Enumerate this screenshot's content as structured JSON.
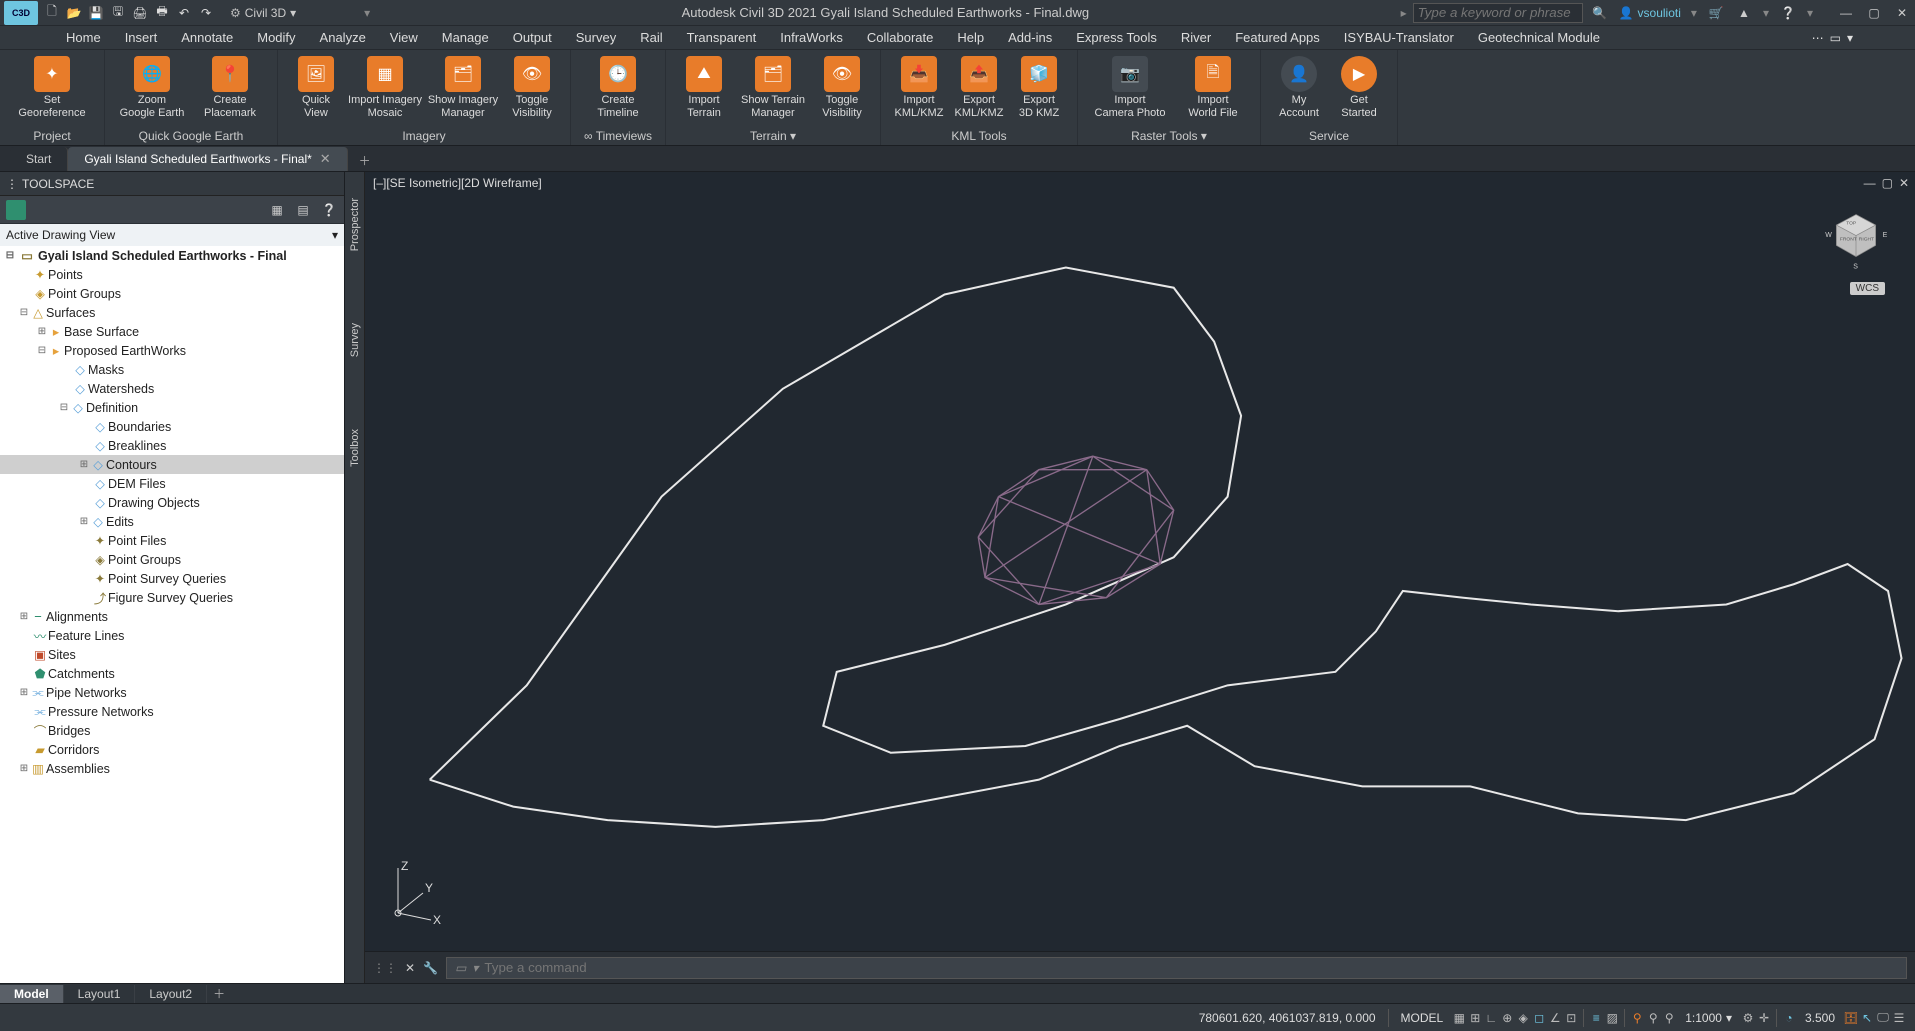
{
  "titlebar": {
    "logo": "C3D",
    "workspace": "Civil 3D",
    "app_title": "Autodesk Civil 3D 2021   Gyali Island Scheduled Earthworks - Final.dwg",
    "search_placeholder": "Type a keyword or phrase",
    "username": "vsoulioti"
  },
  "menu": [
    "Home",
    "Insert",
    "Annotate",
    "Modify",
    "Analyze",
    "View",
    "Manage",
    "Output",
    "Survey",
    "Rail",
    "Transparent",
    "InfraWorks",
    "Collaborate",
    "Help",
    "Add-ins",
    "Express Tools",
    "River",
    "Featured Apps",
    "ISYBAU-Translator",
    "Geotechnical Module"
  ],
  "ribbon": {
    "panels": [
      {
        "title": "Project",
        "buttons": [
          {
            "l1": "Set",
            "l2": "Georeference"
          }
        ]
      },
      {
        "title": "Quick Google Earth",
        "buttons": [
          {
            "l1": "Zoom",
            "l2": "Google Earth"
          },
          {
            "l1": "Create",
            "l2": "Placemark"
          }
        ]
      },
      {
        "title": "Imagery",
        "buttons": [
          {
            "l1": "Quick",
            "l2": "View"
          },
          {
            "l1": "Import Imagery",
            "l2": "Mosaic"
          },
          {
            "l1": "Show Imagery",
            "l2": "Manager"
          },
          {
            "l1": "Toggle",
            "l2": "Visibility"
          }
        ]
      },
      {
        "title": "∞ Timeviews",
        "buttons": [
          {
            "l1": "Create",
            "l2": "Timeline"
          }
        ]
      },
      {
        "title": "Terrain",
        "buttons": [
          {
            "l1": "Import",
            "l2": "Terrain"
          },
          {
            "l1": "Show Terrain",
            "l2": "Manager"
          },
          {
            "l1": "Toggle",
            "l2": "Visibility"
          }
        ]
      },
      {
        "title": "KML Tools",
        "buttons": [
          {
            "l1": "Import",
            "l2": "KML/KMZ"
          },
          {
            "l1": "Export",
            "l2": "KML/KMZ"
          },
          {
            "l1": "Export",
            "l2": "3D KMZ"
          }
        ]
      },
      {
        "title": "Raster Tools",
        "buttons": [
          {
            "l1": "Import",
            "l2": "Camera Photo"
          },
          {
            "l1": "Import",
            "l2": "World File"
          }
        ]
      },
      {
        "title": "Service",
        "buttons": [
          {
            "l1": "My",
            "l2": "Account"
          },
          {
            "l1": "Get",
            "l2": "Started"
          }
        ]
      }
    ]
  },
  "doctabs": {
    "start": "Start",
    "active": "Gyali Island Scheduled Earthworks - Final*"
  },
  "toolspace": {
    "title": "TOOLSPACE",
    "view": "Active Drawing View",
    "side_tabs": [
      "Prospector",
      "Survey",
      "Toolbox"
    ],
    "root": "Gyali Island Scheduled Earthworks - Final",
    "nodes": {
      "points": "Points",
      "pointGroups": "Point Groups",
      "surfaces": "Surfaces",
      "baseSurface": "Base Surface",
      "proposed": "Proposed EarthWorks",
      "masks": "Masks",
      "watersheds": "Watersheds",
      "definition": "Definition",
      "boundaries": "Boundaries",
      "breaklines": "Breaklines",
      "contours": "Contours",
      "demfiles": "DEM Files",
      "drawingObjs": "Drawing Objects",
      "edits": "Edits",
      "pointFiles": "Point Files",
      "pointGroups2": "Point Groups",
      "psq": "Point Survey Queries",
      "fsq": "Figure Survey Queries",
      "alignments": "Alignments",
      "featureLines": "Feature Lines",
      "sites": "Sites",
      "catchments": "Catchments",
      "pipeNet": "Pipe Networks",
      "pressureNet": "Pressure Networks",
      "bridges": "Bridges",
      "corridors": "Corridors",
      "assemblies": "Assemblies"
    }
  },
  "viewport": {
    "label": "[–][SE Isometric][2D Wireframe]",
    "wcs": "WCS",
    "axis_z": "Z",
    "axis_y": "Y",
    "axis_x": "X"
  },
  "command": {
    "placeholder": "Type a command"
  },
  "layouts": [
    "Model",
    "Layout1",
    "Layout2"
  ],
  "status": {
    "coords": "780601.620, 4061037.819, 0.000",
    "model": "MODEL",
    "scale": "1:1000",
    "decimal": "3.500"
  }
}
